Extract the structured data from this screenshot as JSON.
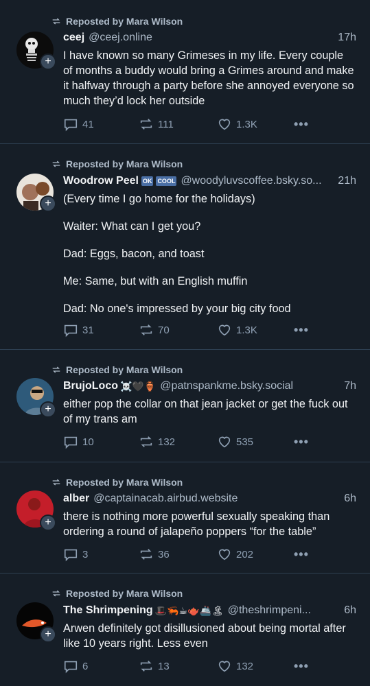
{
  "colors": {
    "background": "#161e27",
    "muted": "#aebbc9",
    "divider": "#2e4052"
  },
  "posts": [
    {
      "reposted_by": "Reposted by Mara Wilson",
      "name": "ceej",
      "badges": "",
      "handle": "@ceej.online",
      "time": "17h",
      "paragraphs": [
        "I have known so many Grimeses in my life. Every couple of months a buddy would bring a Grimes around and make it halfway through a party before she annoyed everyone so much they’d lock her outside"
      ],
      "replies": "41",
      "reposts": "111",
      "likes": "1.3K"
    },
    {
      "reposted_by": "Reposted by Mara Wilson",
      "name": "Woodrow Peel",
      "badges": "",
      "handle": "@woodyluvscoffee.bsky.so...",
      "time": "21h",
      "paragraphs": [
        "(Every time I go home for the holidays)",
        "Waiter: What can I get you?",
        "Dad: Eggs, bacon, and toast",
        "Me: Same, but with an English muffin",
        "Dad: No one's impressed by your big city food"
      ],
      "replies": "31",
      "reposts": "70",
      "likes": "1.3K"
    },
    {
      "reposted_by": "Reposted by Mara Wilson",
      "name": "BrujoLoco",
      "badges": "☠️🖤🏺",
      "handle": "@patnspankme.bsky.social",
      "time": "7h",
      "paragraphs": [
        "either pop the collar on that jean jacket or get the fuck out of my trans am"
      ],
      "replies": "10",
      "reposts": "132",
      "likes": "535"
    },
    {
      "reposted_by": "Reposted by Mara Wilson",
      "name": "alber",
      "badges": "",
      "handle": "@captainacab.airbud.website",
      "time": "6h",
      "paragraphs": [
        "there is nothing more powerful sexually speaking than ordering a round of jalapeño poppers “for the table”"
      ],
      "replies": "3",
      "reposts": "36",
      "likes": "202"
    },
    {
      "reposted_by": "Reposted by Mara Wilson",
      "name": "The Shrimpening",
      "badges": "🎩🦐☕🫖🚢🏝",
      "handle": "@theshrimpeni...",
      "time": "6h",
      "paragraphs": [
        "Arwen definitely got disillusioned about being mortal after like 10 years right. Less even"
      ],
      "replies": "6",
      "reposts": "13",
      "likes": "132"
    }
  ]
}
